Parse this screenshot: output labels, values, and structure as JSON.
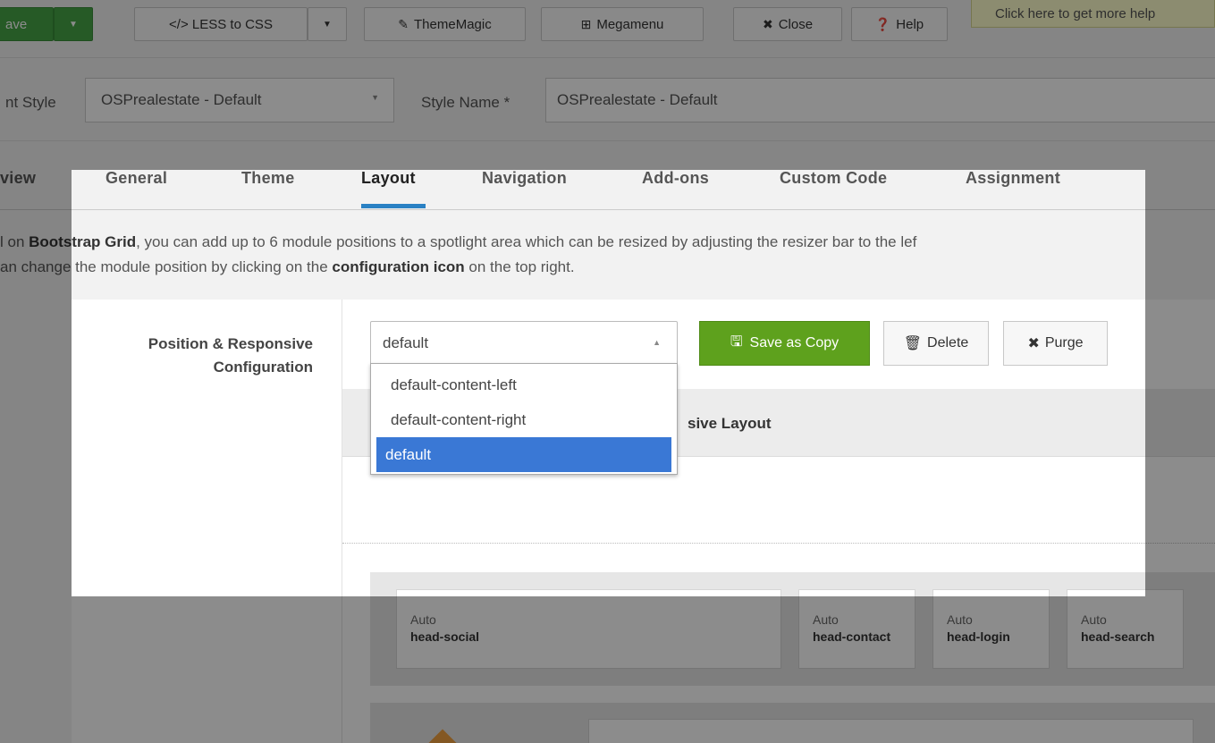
{
  "toolbar": {
    "save_label": "ave",
    "less_label": "</> LESS to CSS",
    "magic_label": "ThemeMagic",
    "megamenu_label": "Megamenu",
    "close_label": "Close",
    "help_label": "Help",
    "help_tip": "Click here to get more help"
  },
  "style_row": {
    "style_label": "nt Style",
    "style_value": "OSPrealestate - Default",
    "name_label": "Style Name *",
    "name_value": "OSPrealestate - Default"
  },
  "tabs": [
    {
      "label": "view"
    },
    {
      "label": "General"
    },
    {
      "label": "Theme"
    },
    {
      "label": "Layout"
    },
    {
      "label": "Navigation"
    },
    {
      "label": "Add-ons"
    },
    {
      "label": "Custom Code"
    },
    {
      "label": "Assignment"
    }
  ],
  "info": {
    "line1_a": "l on ",
    "line1_b": "Bootstrap Grid",
    "line1_c": ", you can add up to 6 module positions to a spotlight area which can be resized by adjusting the resizer bar to the lef",
    "line2_a": "an change the module position by clicking on the ",
    "line2_b": "configuration icon",
    "line2_c": " on the top right."
  },
  "config": {
    "label_line1": "Position & Responsive",
    "label_line2": "Configuration",
    "layout_value": "default",
    "save_as_copy": "Save as Copy",
    "delete": "Delete",
    "purge": "Purge",
    "responsive_title": "sive Layout"
  },
  "dropdown": {
    "options": [
      "default-content-left",
      "default-content-right",
      "default"
    ]
  },
  "positions": [
    {
      "auto": "Auto",
      "name": "head-social"
    },
    {
      "auto": "Auto",
      "name": "head-contact"
    },
    {
      "auto": "Auto",
      "name": "head-login"
    },
    {
      "auto": "Auto",
      "name": "head-search"
    }
  ],
  "colors": {
    "accent_blue": "#2a81c4",
    "save_green": "#5ea11d",
    "selected_option": "#3a78d5"
  }
}
